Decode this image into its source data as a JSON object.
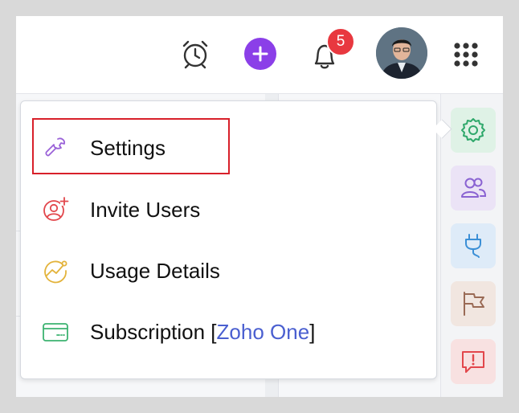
{
  "header": {
    "notification_count": "5",
    "icons": [
      "alarm-clock-icon",
      "add-icon",
      "bell-icon",
      "apps-grid-icon"
    ],
    "avatar": "user-avatar"
  },
  "menu": {
    "items": [
      {
        "label": "Settings",
        "icon": "wrench-icon",
        "highlighted": true
      },
      {
        "label": "Invite Users",
        "icon": "invite-user-icon"
      },
      {
        "label": "Usage Details",
        "icon": "usage-chart-icon"
      },
      {
        "label": "Subscription [",
        "link": "Zoho One",
        "suffix": "]",
        "icon": "card-icon"
      }
    ]
  },
  "rail": {
    "buttons": [
      {
        "icon": "gear-icon",
        "color": "#2fa86b",
        "bg": "#dff2e6"
      },
      {
        "icon": "users-icon",
        "color": "#8a63d2",
        "bg": "#ebe3f6"
      },
      {
        "icon": "plug-icon",
        "color": "#3b8fd6",
        "bg": "#deebf8"
      },
      {
        "icon": "flag-icon",
        "color": "#9a6a55",
        "bg": "#f1e6e0"
      },
      {
        "icon": "feedback-icon",
        "color": "#e2474c",
        "bg": "#f8e1e1"
      }
    ]
  },
  "colors": {
    "accent": "#8b3fe8",
    "badge": "#e8383f",
    "highlight": "#d8202a",
    "link": "#4a5fd0"
  }
}
